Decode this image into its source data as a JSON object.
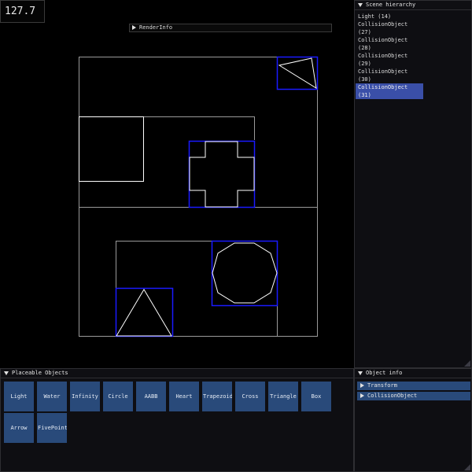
{
  "fps": "127.7",
  "render_info": {
    "label": "RenderInfo"
  },
  "scene_hierarchy": {
    "title": "Scene hierarchy",
    "items": [
      {
        "label": "Light (14)",
        "selected": false
      },
      {
        "label": "CollisionObject (27)",
        "selected": false
      },
      {
        "label": "CollisionObject (28)",
        "selected": false
      },
      {
        "label": "CollisionObject (29)",
        "selected": false
      },
      {
        "label": "CollisionObject (30)",
        "selected": false
      },
      {
        "label": "CollisionObject (31)",
        "selected": true
      }
    ]
  },
  "placeable_objects": {
    "title": "Placeable Objects",
    "buttons": [
      "Light",
      "Water",
      "Infinity",
      "Circle",
      "AABB",
      "Heart",
      "Trapezoid",
      "Cross",
      "Triangle",
      "Box",
      "Arrow",
      "FivePoint"
    ]
  },
  "object_info": {
    "title": "Object info",
    "sections": [
      "Transform",
      "CollisionObject"
    ]
  },
  "colors": {
    "selection": "#3a4fa8",
    "button": "#294a7a",
    "bounding_box": "#1a1aff",
    "shape": "#ffffff",
    "wall": "#9a9a9a"
  }
}
